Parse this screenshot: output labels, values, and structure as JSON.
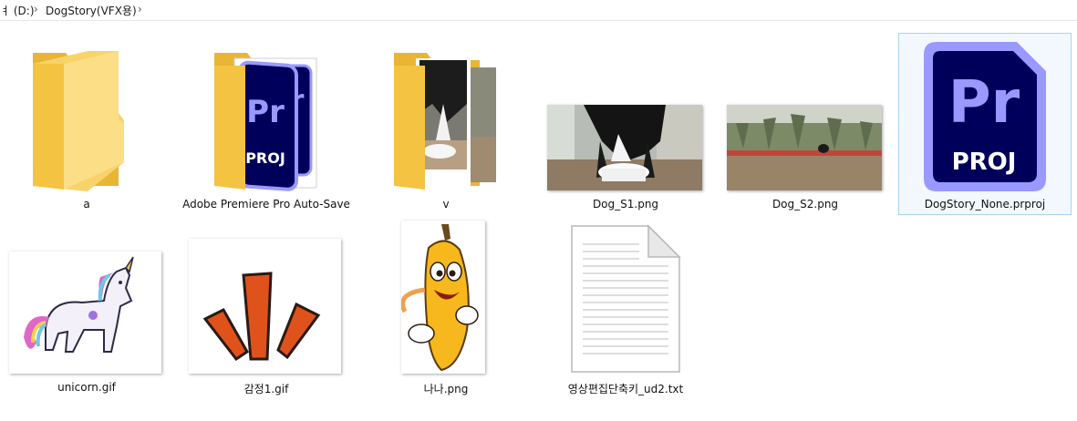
{
  "breadcrumb": {
    "drive": "로컬 디스크 (D:)",
    "drive_visible": "ㅕ (D:)",
    "folder": "DogStory(VFX용)"
  },
  "files": [
    {
      "name": "a",
      "type": "folder-icon"
    },
    {
      "name": "Adobe Premiere Pro Auto-Save",
      "type": "folder-icon"
    },
    {
      "name": "v",
      "type": "folder-icon"
    },
    {
      "name": "Dog_S1.png",
      "type": "image"
    },
    {
      "name": "Dog_S2.png",
      "type": "image"
    },
    {
      "name": "DogStory_None.prproj",
      "type": "premiere-project",
      "selected": true
    },
    {
      "name": "unicorn.gif",
      "type": "image"
    },
    {
      "name": "감정1.gif",
      "type": "image"
    },
    {
      "name": "나나.png",
      "type": "image"
    },
    {
      "name": "영상편집단축키_ud2.txt",
      "type": "text-document"
    }
  ],
  "icons": {
    "premiere_text": "Pr",
    "proj_text": "PROJ"
  },
  "colors": {
    "folder": "#f5c342",
    "folder_light": "#fad978",
    "premiere_bg": "#00005b",
    "premiere_accent": "#9999ff",
    "selection_bg": "#f2f8fd",
    "selection_border": "#a9d3f1"
  }
}
